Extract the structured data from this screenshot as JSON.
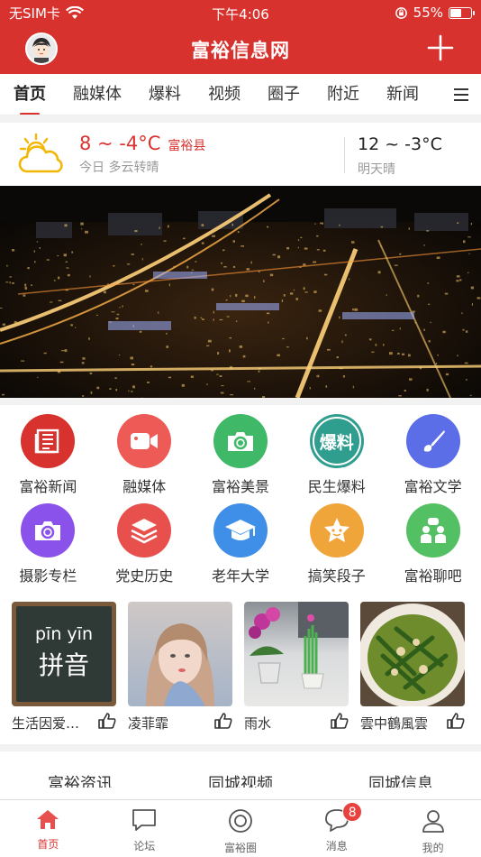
{
  "status_bar": {
    "carrier": "无SIM卡",
    "time": "下午4:06",
    "battery_text": "55%",
    "battery_level": 0.55
  },
  "header": {
    "title": "富裕信息网",
    "avatar_icon": "avatar-icon",
    "plus_icon": "plus-icon"
  },
  "tabs": [
    "首页",
    "融媒体",
    "爆料",
    "视频",
    "圈子",
    "附近",
    "新闻"
  ],
  "weather": {
    "today_temp": "8 ~ -4°C",
    "city": "富裕县",
    "today_desc": "今日 多云转晴",
    "tomorrow_temp": "12 ~ -3°C",
    "tomorrow_desc": "明天晴",
    "icon": "partly-cloudy-icon"
  },
  "grid": [
    {
      "label": "富裕新闻",
      "color": "#d8322f",
      "icon": "newspaper-icon"
    },
    {
      "label": "融媒体",
      "color": "#ee5a55",
      "icon": "video-camera-icon"
    },
    {
      "label": "富裕美景",
      "color": "#3fb868",
      "icon": "camera-icon"
    },
    {
      "label": "民生爆料",
      "color": "#2f9e8f",
      "icon": "baoliao-text-icon",
      "icon_text": "爆料"
    },
    {
      "label": "富裕文学",
      "color": "#5b6ee8",
      "icon": "brush-icon"
    },
    {
      "label": "摄影专栏",
      "color": "#8a52ea",
      "icon": "camera-icon"
    },
    {
      "label": "党史历史",
      "color": "#e8504d",
      "icon": "layers-icon"
    },
    {
      "label": "老年大学",
      "color": "#3f8ee8",
      "icon": "graduation-cap-icon"
    },
    {
      "label": "搞笑段子",
      "color": "#f0a53a",
      "icon": "smile-star-icon"
    },
    {
      "label": "富裕聊吧",
      "color": "#52c063",
      "icon": "chat-people-icon"
    }
  ],
  "thumbs": [
    {
      "name": "生活因爱…",
      "img_text_top": "pīn yīn",
      "img_text_main": "拼音"
    },
    {
      "name": "凌菲霏"
    },
    {
      "name": "雨水"
    },
    {
      "name": "雲中鶴風雲"
    }
  ],
  "section_tabs": [
    "富裕资讯",
    "同城视频",
    "同城信息"
  ],
  "bottom_nav": [
    {
      "label": "首页",
      "icon": "home-icon",
      "active": true
    },
    {
      "label": "论坛",
      "icon": "forum-icon"
    },
    {
      "label": "富裕圈",
      "icon": "circle-icon"
    },
    {
      "label": "消息",
      "icon": "message-icon",
      "badge": "8"
    },
    {
      "label": "我的",
      "icon": "user-icon"
    }
  ],
  "colors": {
    "brand": "#d8322f",
    "bg_gray": "#f2f2f2"
  }
}
